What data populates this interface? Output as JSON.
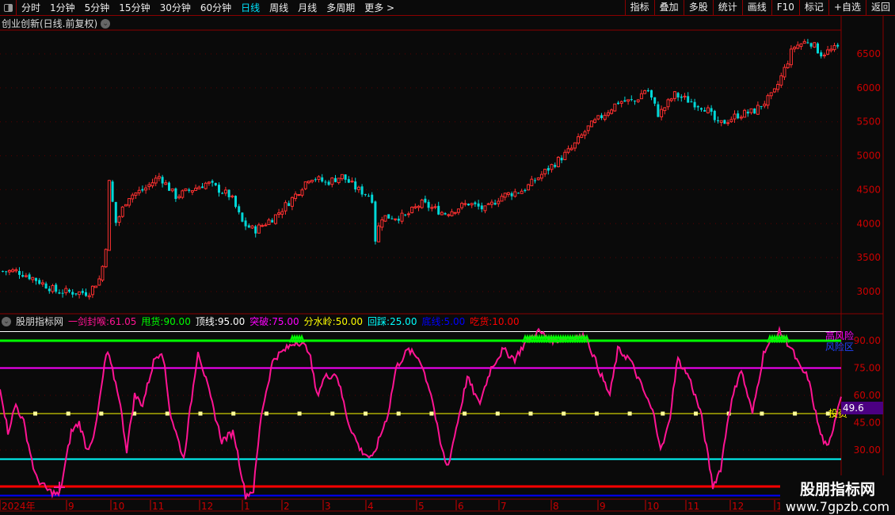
{
  "toolbar": {
    "periods": [
      "分时",
      "1分钟",
      "5分钟",
      "15分钟",
      "30分钟",
      "60分钟",
      "日线",
      "周线",
      "月线",
      "多周期",
      "更多 >"
    ],
    "active": "日线",
    "right": [
      "指标",
      "叠加",
      "多股",
      "统计",
      "画线",
      "F10",
      "标记",
      "+自选",
      "返回"
    ]
  },
  "chart_title": "创业创新(日线.前复权)",
  "price_axis": [
    "6500",
    "6000",
    "5500",
    "5000",
    "4500",
    "4000",
    "3500",
    "3000"
  ],
  "indicator": {
    "name": "股朋指标网",
    "items": [
      {
        "label": "一剑封喉:",
        "value": "61.05",
        "color": "#ff1493"
      },
      {
        "label": "甩货:",
        "value": "90.00",
        "color": "#00ff00"
      },
      {
        "label": "顶线:",
        "value": "95.00",
        "color": "#ffffff"
      },
      {
        "label": "突破:",
        "value": "75.00",
        "color": "#ff00ff"
      },
      {
        "label": "分水岭:",
        "value": "50.00",
        "color": "#ffff00"
      },
      {
        "label": "回踩:",
        "value": "25.00",
        "color": "#00ffff"
      },
      {
        "label": "底线:",
        "value": "5.00",
        "color": "#0000ff"
      },
      {
        "label": "吃货:",
        "value": "10.00",
        "color": "#ff0000"
      }
    ],
    "axis": [
      "90.00",
      "75.00",
      "60.00",
      "45.00",
      "30.00"
    ],
    "current": "49.6",
    "tag_high": "高风险",
    "tag_risk": "风险区",
    "tag_invest": "投资"
  },
  "date_axis": [
    "2024年",
    "9",
    "10",
    "11",
    "12",
    "1",
    "2",
    "3",
    "4",
    "5",
    "6",
    "7",
    "8",
    "9",
    "10",
    "11",
    "12",
    "1"
  ],
  "watermark": {
    "title": "股朋指标网",
    "url": "www.7gpzb.com"
  },
  "chart_data": {
    "type": "candlestick+line",
    "price_keypoints": [
      [
        0,
        3300
      ],
      [
        20,
        3300
      ],
      [
        40,
        3200
      ],
      [
        70,
        3000
      ],
      [
        110,
        2980
      ],
      [
        125,
        3200
      ],
      [
        132,
        3600
      ],
      [
        135,
        4700
      ],
      [
        145,
        4000
      ],
      [
        160,
        4400
      ],
      [
        180,
        4500
      ],
      [
        200,
        4700
      ],
      [
        220,
        4400
      ],
      [
        240,
        4500
      ],
      [
        260,
        4600
      ],
      [
        290,
        4400
      ],
      [
        305,
        4000
      ],
      [
        320,
        3900
      ],
      [
        345,
        4100
      ],
      [
        370,
        4400
      ],
      [
        390,
        4700
      ],
      [
        410,
        4600
      ],
      [
        430,
        4700
      ],
      [
        450,
        4500
      ],
      [
        468,
        4400
      ],
      [
        472,
        3750
      ],
      [
        480,
        4100
      ],
      [
        510,
        4100
      ],
      [
        530,
        4300
      ],
      [
        560,
        4150
      ],
      [
        590,
        4300
      ],
      [
        612,
        4200
      ],
      [
        630,
        4400
      ],
      [
        660,
        4500
      ],
      [
        690,
        4800
      ],
      [
        720,
        5100
      ],
      [
        740,
        5400
      ],
      [
        760,
        5600
      ],
      [
        780,
        5800
      ],
      [
        800,
        5800
      ],
      [
        815,
        6000
      ],
      [
        830,
        5600
      ],
      [
        850,
        5900
      ],
      [
        870,
        5800
      ],
      [
        890,
        5700
      ],
      [
        905,
        5450
      ],
      [
        930,
        5600
      ],
      [
        950,
        5650
      ],
      [
        975,
        5900
      ],
      [
        990,
        6300
      ],
      [
        1000,
        6600
      ],
      [
        1020,
        6700
      ],
      [
        1035,
        6500
      ],
      [
        1060,
        6600
      ]
    ],
    "osc_keypoints": [
      [
        0,
        65
      ],
      [
        10,
        40
      ],
      [
        20,
        55
      ],
      [
        30,
        45
      ],
      [
        45,
        15
      ],
      [
        60,
        8
      ],
      [
        75,
        5
      ],
      [
        90,
        40
      ],
      [
        100,
        45
      ],
      [
        110,
        30
      ],
      [
        120,
        40
      ],
      [
        135,
        85
      ],
      [
        150,
        60
      ],
      [
        160,
        30
      ],
      [
        170,
        60
      ],
      [
        180,
        55
      ],
      [
        195,
        80
      ],
      [
        205,
        85
      ],
      [
        215,
        50
      ],
      [
        232,
        25
      ],
      [
        250,
        85
      ],
      [
        265,
        60
      ],
      [
        280,
        35
      ],
      [
        295,
        40
      ],
      [
        310,
        5
      ],
      [
        320,
        8
      ],
      [
        330,
        50
      ],
      [
        345,
        80
      ],
      [
        360,
        85
      ],
      [
        375,
        90
      ],
      [
        390,
        85
      ],
      [
        400,
        60
      ],
      [
        410,
        70
      ],
      [
        425,
        72
      ],
      [
        440,
        45
      ],
      [
        455,
        30
      ],
      [
        470,
        25
      ],
      [
        490,
        50
      ],
      [
        500,
        75
      ],
      [
        515,
        85
      ],
      [
        530,
        80
      ],
      [
        545,
        60
      ],
      [
        555,
        35
      ],
      [
        565,
        20
      ],
      [
        575,
        40
      ],
      [
        590,
        70
      ],
      [
        605,
        55
      ],
      [
        620,
        75
      ],
      [
        635,
        85
      ],
      [
        650,
        80
      ],
      [
        665,
        90
      ],
      [
        680,
        95
      ],
      [
        700,
        90
      ],
      [
        720,
        92
      ],
      [
        740,
        92
      ],
      [
        760,
        70
      ],
      [
        770,
        60
      ],
      [
        780,
        85
      ],
      [
        795,
        80
      ],
      [
        810,
        65
      ],
      [
        825,
        50
      ],
      [
        835,
        30
      ],
      [
        845,
        45
      ],
      [
        855,
        80
      ],
      [
        870,
        70
      ],
      [
        885,
        50
      ],
      [
        900,
        10
      ],
      [
        910,
        20
      ],
      [
        920,
        50
      ],
      [
        935,
        75
      ],
      [
        950,
        50
      ],
      [
        965,
        85
      ],
      [
        985,
        95
      ],
      [
        1000,
        85
      ],
      [
        1010,
        75
      ],
      [
        1020,
        70
      ],
      [
        1035,
        40
      ],
      [
        1045,
        30
      ],
      [
        1062,
        61
      ]
    ],
    "levels": [
      95,
      90,
      75,
      50,
      25,
      10,
      5
    ]
  }
}
